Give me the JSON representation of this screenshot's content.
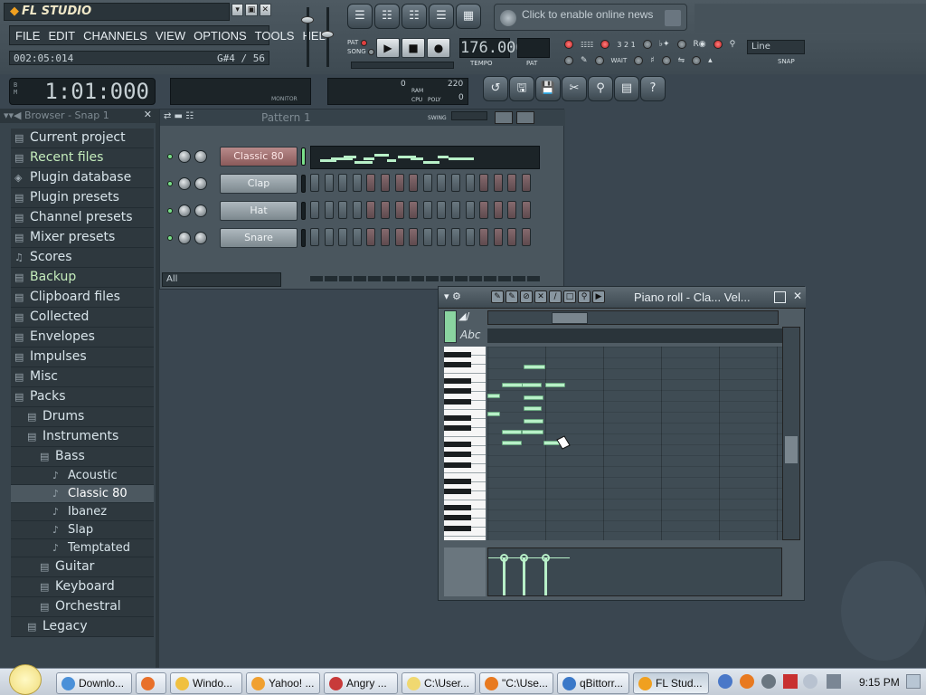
{
  "app": {
    "logo": "FL STUDIO",
    "menu": [
      "FILE",
      "EDIT",
      "CHANNELS",
      "VIEW",
      "OPTIONS",
      "TOOLS",
      "HELP"
    ],
    "time_display": "002:05:014",
    "note_info": "G#4 / 56",
    "big_time": "1:01:000",
    "news_text": "Click to enable online news",
    "tempo": "176.000",
    "tempo_label": "TEMPO",
    "pat_label": "PAT",
    "pat_song": [
      "PAT",
      "SONG"
    ],
    "snap_value": "Line",
    "snap_label": "SNAP",
    "monitor_label": "MONITOR",
    "cpu_value": "0",
    "ram_value": "220",
    "cpu_labels": [
      "RAM",
      "CPU",
      "POLY"
    ],
    "poly_value": "0"
  },
  "browser": {
    "header": "Browser - Snap 1",
    "items": [
      {
        "label": "Current project",
        "icon": "folder-icon"
      },
      {
        "label": "Recent files",
        "icon": "folder-icon"
      },
      {
        "label": "Plugin database",
        "icon": "plugin-icon"
      },
      {
        "label": "Plugin presets",
        "icon": "folder-icon"
      },
      {
        "label": "Channel presets",
        "icon": "folder-icon"
      },
      {
        "label": "Mixer presets",
        "icon": "folder-icon"
      },
      {
        "label": "Scores",
        "icon": "note-icon"
      },
      {
        "label": "Backup",
        "icon": "folder-icon"
      },
      {
        "label": "Clipboard files",
        "icon": "folder-icon"
      },
      {
        "label": "Collected",
        "icon": "folder-icon"
      },
      {
        "label": "Envelopes",
        "icon": "folder-icon"
      },
      {
        "label": "Impulses",
        "icon": "folder-icon"
      },
      {
        "label": "Misc",
        "icon": "folder-icon"
      },
      {
        "label": "Packs",
        "icon": "folder-icon"
      },
      {
        "label": "Drums",
        "icon": "folder-icon"
      },
      {
        "label": "Instruments",
        "icon": "folder-icon"
      },
      {
        "label": "Bass",
        "icon": "folder-icon"
      },
      {
        "label": "Acoustic",
        "icon": "file-icon"
      },
      {
        "label": "Classic 80",
        "icon": "file-icon"
      },
      {
        "label": "Ibanez",
        "icon": "file-icon"
      },
      {
        "label": "Slap",
        "icon": "file-icon"
      },
      {
        "label": "Temptated",
        "icon": "file-icon"
      },
      {
        "label": "Guitar",
        "icon": "folder-icon"
      },
      {
        "label": "Keyboard",
        "icon": "folder-icon"
      },
      {
        "label": "Orchestral",
        "icon": "folder-icon"
      },
      {
        "label": "Legacy",
        "icon": "folder-icon"
      }
    ]
  },
  "rack": {
    "header": "Pattern 1",
    "swing_label": "SWING",
    "channels": [
      "Classic 80",
      "Clap",
      "Hat",
      "Snare"
    ],
    "filter": "All"
  },
  "piano_roll": {
    "title": "Piano roll - Cla...  Vel...",
    "abc": "Abc"
  },
  "taskbar": {
    "tasks": [
      "Downlo...",
      "",
      "Windo...",
      "Yahoo! ...",
      "Angry ...",
      "C:\\User...",
      "\"C:\\Use...",
      "qBittorr...",
      "FL Stud..."
    ],
    "clock": "9:15 PM"
  }
}
